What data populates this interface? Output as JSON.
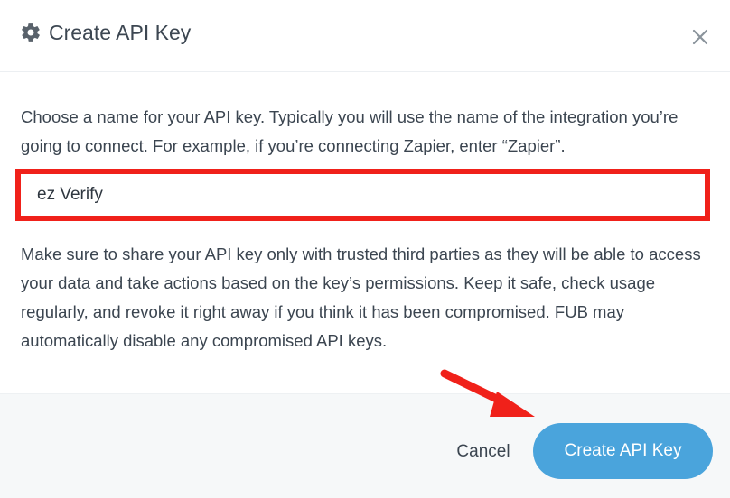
{
  "dialog": {
    "title": "Create API Key",
    "title_icon": "gear-icon",
    "close_icon": "close-icon"
  },
  "body": {
    "intro_text": "Choose a name for your API key. Typically you will use the name of the integration you’re going to connect. For example, if you’re connecting Zapier, enter “Zapier”.",
    "name_field": {
      "value": "ez Verify",
      "placeholder": ""
    },
    "notice_text": "Make sure to share your API key only with trusted third parties as they will be able to access your data and take actions based on the key’s permissions. Keep it safe, check usage regularly, and revoke it right away if you think it has been compromised. FUB may automatically disable any compromised API keys."
  },
  "footer": {
    "cancel_label": "Cancel",
    "create_label": "Create API Key"
  },
  "colors": {
    "primary_button": "#4aa4dc",
    "annotation_red": "#f0211a",
    "footer_bg": "#f6f8f9",
    "text": "#3b4550"
  }
}
